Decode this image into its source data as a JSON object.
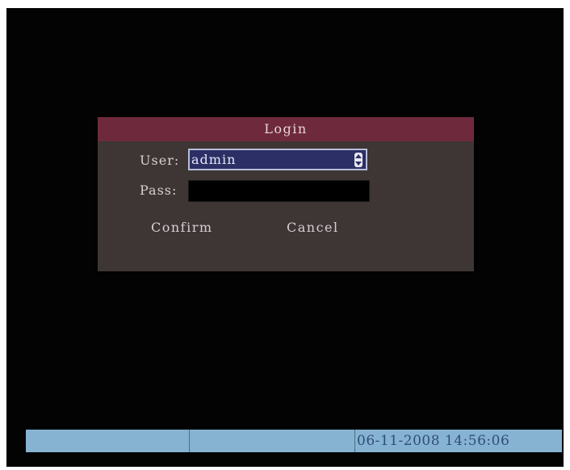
{
  "dialog": {
    "title": "Login",
    "user_label": "User:",
    "user_value": "admin",
    "pass_label": "Pass:",
    "pass_value": "",
    "confirm_label": "Confirm",
    "cancel_label": "Cancel"
  },
  "status_bar": {
    "datetime": "06-11-2008 14:56:06"
  },
  "colors": {
    "screen_bg": "#030303",
    "dialog_bg": "#3e3535",
    "title_bar": "#6e2a3c",
    "selected_field": "#2b2f66",
    "status_bar": "#87b3d2"
  },
  "icons": {
    "user_spinner": "updown-spin-icon"
  }
}
